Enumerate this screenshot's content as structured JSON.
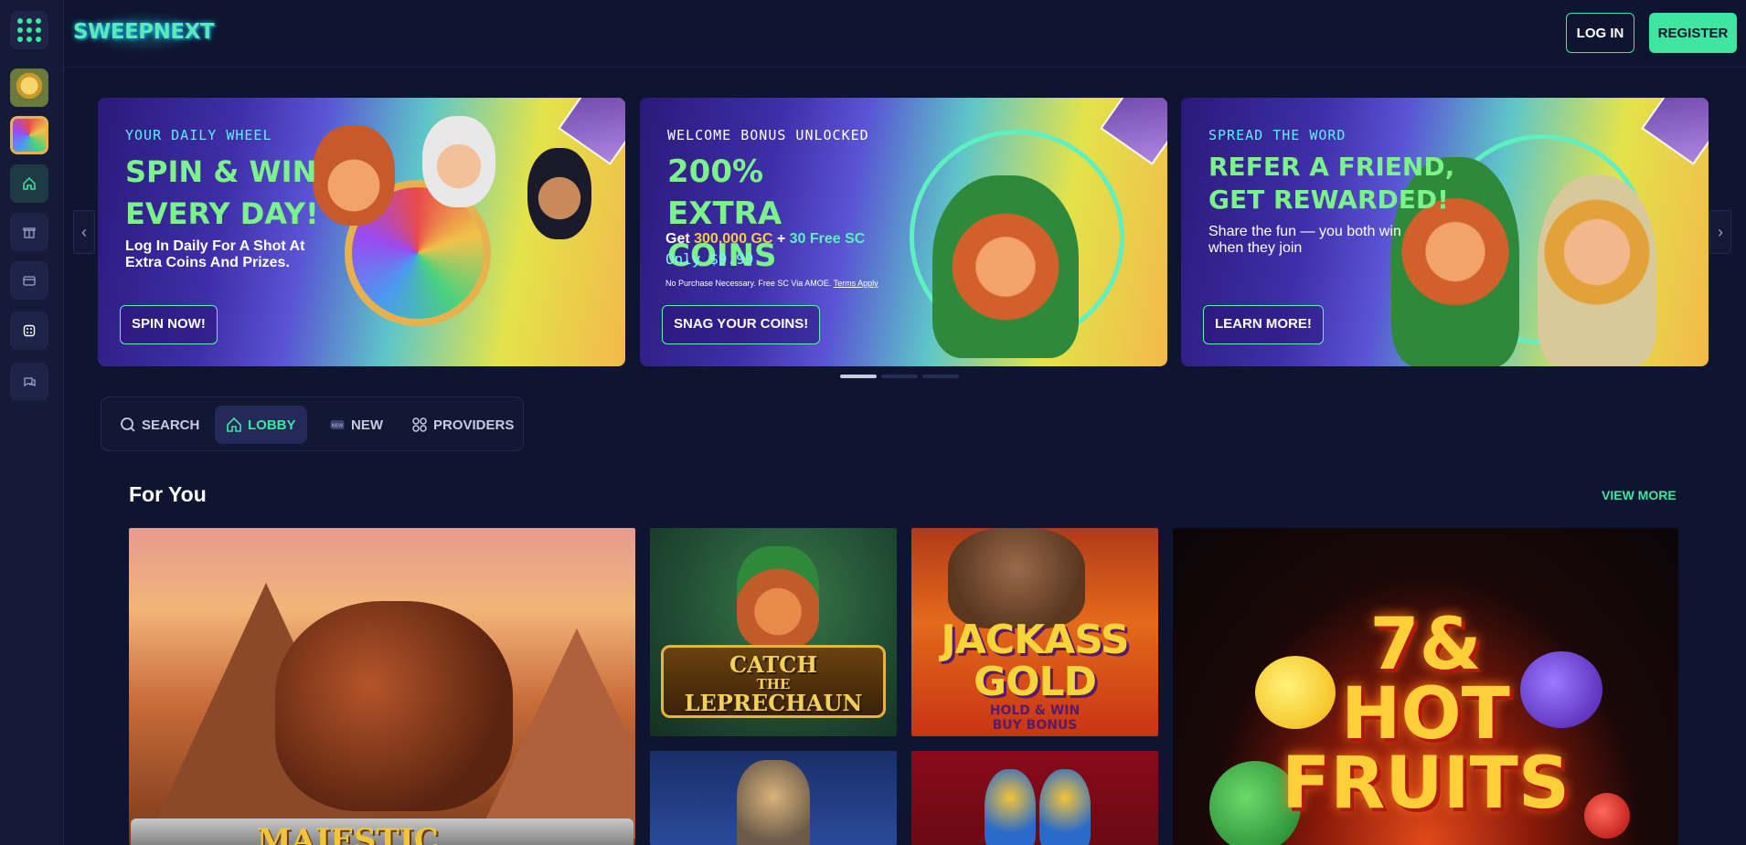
{
  "header": {
    "logo": "SWEEPNEXT",
    "login_label": "LOG IN",
    "register_label": "REGISTER"
  },
  "banners": [
    {
      "kicker": "YOUR DAILY WHEEL",
      "headline": "SPIN & WIN EVERY DAY!",
      "sub": "Log In Daily For A Shot At Extra Coins And Prizes.",
      "cta": "SPIN NOW!"
    },
    {
      "kicker": "WELCOME BONUS UNLOCKED",
      "headline": "200% EXTRA COINS",
      "offer_prefix": "Get ",
      "offer_gc": "300,000 GC",
      "offer_plus": " + ",
      "offer_sc": "30 Free SC",
      "price": "Only $9.99",
      "fine_print": "No Purchase Necessary. Free SC Via AMOE. ",
      "terms": "Terms Apply",
      "cta": "SNAG YOUR COINS!"
    },
    {
      "kicker": "SPREAD THE WORD",
      "headline": "REFER A FRIEND, GET REWARDED!",
      "sub": "Share the fun — you both win when they join",
      "cta": "LEARN MORE!"
    }
  ],
  "carousel": {
    "active_index": 0,
    "count": 3
  },
  "tabs": [
    {
      "label": "SEARCH",
      "icon": "search-icon",
      "active": false
    },
    {
      "label": "LOBBY",
      "icon": "home-icon",
      "active": true
    },
    {
      "label": "NEW",
      "icon": "new-badge-icon",
      "active": false
    },
    {
      "label": "PROVIDERS",
      "icon": "providers-icon",
      "active": false
    }
  ],
  "section": {
    "title": "For You",
    "view_more": "VIEW MORE"
  },
  "games": {
    "g1": "MAJESTIC",
    "g2_the": "THE",
    "g2_catch": "CATCH",
    "g2_leprechaun": "LEPRECHAUN",
    "g3_line1": "JACKASS",
    "g3_line2": "GOLD",
    "g3_line3": "HOLD & WIN",
    "g3_line4": "BUY BONUS",
    "g6_line1": "7&",
    "g6_line2": "HOT",
    "g6_line3": "FRUITS"
  },
  "colors": {
    "background": "#0f1530",
    "accent": "#3ee6a0",
    "sidebar": "#141a38"
  }
}
